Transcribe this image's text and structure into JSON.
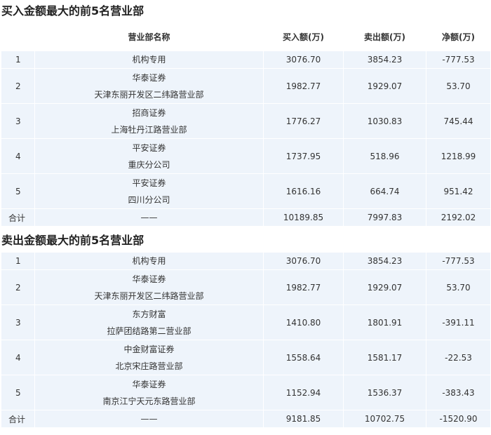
{
  "buy_section": {
    "title": "买入金额最大的前5名营业部",
    "headers": [
      "",
      "营业部名称",
      "买入额(万)",
      "卖出额(万)",
      "净额(万)"
    ],
    "rows": [
      {
        "rank": "1",
        "name_lines": [
          "机构专用"
        ],
        "buy": "3076.70",
        "sell": "3854.23",
        "net": "-777.53"
      },
      {
        "rank": "2",
        "name_lines": [
          "华泰证券",
          "天津东丽开发区二纬路营业部"
        ],
        "buy": "1982.77",
        "sell": "1929.07",
        "net": "53.70"
      },
      {
        "rank": "3",
        "name_lines": [
          "招商证券",
          "上海牡丹江路营业部"
        ],
        "buy": "1776.27",
        "sell": "1030.83",
        "net": "745.44"
      },
      {
        "rank": "4",
        "name_lines": [
          "平安证券",
          "重庆分公司"
        ],
        "buy": "1737.95",
        "sell": "518.96",
        "net": "1218.99"
      },
      {
        "rank": "5",
        "name_lines": [
          "平安证券",
          "四川分公司"
        ],
        "buy": "1616.16",
        "sell": "664.74",
        "net": "951.42"
      }
    ],
    "total": {
      "label": "合计",
      "name": "——",
      "buy": "10189.85",
      "sell": "7997.83",
      "net": "2192.02"
    }
  },
  "sell_section": {
    "title": "卖出金额最大的前5名营业部",
    "rows": [
      {
        "rank": "1",
        "name_lines": [
          "机构专用"
        ],
        "buy": "3076.70",
        "sell": "3854.23",
        "net": "-777.53"
      },
      {
        "rank": "2",
        "name_lines": [
          "华泰证券",
          "天津东丽开发区二纬路营业部"
        ],
        "buy": "1982.77",
        "sell": "1929.07",
        "net": "53.70"
      },
      {
        "rank": "3",
        "name_lines": [
          "东方财富",
          "拉萨团结路第二营业部"
        ],
        "buy": "1410.80",
        "sell": "1801.91",
        "net": "-391.11"
      },
      {
        "rank": "4",
        "name_lines": [
          "中金财富证券",
          "北京宋庄路营业部"
        ],
        "buy": "1558.64",
        "sell": "1581.17",
        "net": "-22.53"
      },
      {
        "rank": "5",
        "name_lines": [
          "华泰证券",
          "南京江宁天元东路营业部"
        ],
        "buy": "1152.94",
        "sell": "1536.37",
        "net": "-383.43"
      }
    ],
    "total": {
      "label": "合计",
      "name": "——",
      "buy": "9181.85",
      "sell": "10702.75",
      "net": "-1520.90"
    }
  }
}
